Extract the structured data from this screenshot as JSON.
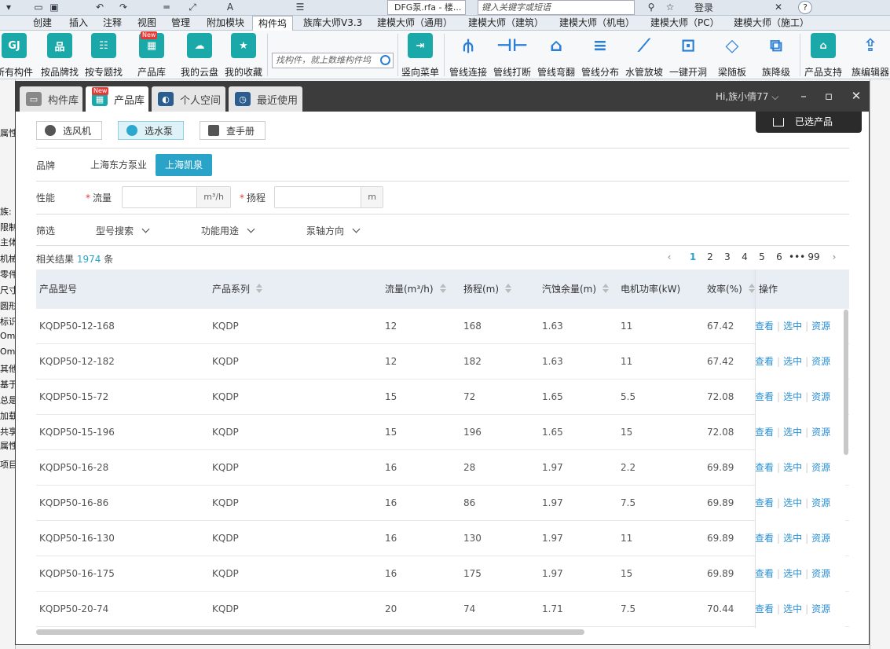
{
  "app": {
    "doc_name": "DFG泵.rfa - 楼...",
    "search_placeholder": "键入关键字或短语",
    "login": "登录",
    "help": "?"
  },
  "menubar": {
    "tabs": [
      "创建",
      "插入",
      "注释",
      "视图",
      "管理",
      "附加模块",
      "构件坞",
      "族库大师V3.3",
      "建模大师（通用）",
      "建模大师（建筑）",
      "建模大师（机电）",
      "建模大师（PC）",
      "建模大师（施工）"
    ],
    "active": "构件坞"
  },
  "ribbon": {
    "buttons_left": [
      {
        "label": "所有构件",
        "icon": "gj-logo-icon"
      },
      {
        "label": "按品牌找",
        "icon": "brand-icon"
      },
      {
        "label": "按专题找",
        "icon": "topic-icon"
      },
      {
        "label": "产品库",
        "icon": "product-library-icon",
        "badge": "New"
      },
      {
        "label": "我的云盘",
        "icon": "cloud-disk-icon"
      },
      {
        "label": "我的收藏",
        "icon": "star-icon"
      }
    ],
    "search_placeholder": "找构件，就上数维构件坞",
    "buttons_right": [
      {
        "label": "竖向菜单",
        "icon": "vertical-menu-icon"
      },
      {
        "label": "管线连接",
        "icon": "pipe-connect-icon"
      },
      {
        "label": "管线打断",
        "icon": "pipe-break-icon"
      },
      {
        "label": "管线弯翻",
        "icon": "pipe-bend-icon"
      },
      {
        "label": "管线分布",
        "icon": "pipe-distribute-icon"
      },
      {
        "label": "水管放坡",
        "icon": "pipe-slope-icon"
      },
      {
        "label": "一键开洞",
        "icon": "open-hole-icon"
      },
      {
        "label": "梁随板",
        "icon": "beam-slab-icon"
      },
      {
        "label": "族降级",
        "icon": "family-downgrade-icon"
      },
      {
        "label": "产品支持",
        "icon": "home-icon"
      },
      {
        "label": "族编辑器",
        "icon": "family-editor-icon"
      }
    ]
  },
  "left_panel": [
    "属性",
    "族:",
    "限制条",
    "主体",
    "机械",
    "零件",
    "尺寸",
    "圆形",
    "标识数",
    "Om",
    "Om",
    "其他",
    "基于",
    "总是",
    "加载",
    "共享",
    "属性",
    "项目浏"
  ],
  "dialog": {
    "tabs": [
      {
        "label": "构件库",
        "icon": "component-library-icon"
      },
      {
        "label": "产品库",
        "icon": "product-library-icon",
        "badge": "New"
      },
      {
        "label": "个人空间",
        "icon": "personal-space-icon"
      },
      {
        "label": "最近使用",
        "icon": "recent-use-icon"
      }
    ],
    "active_tab": "产品库",
    "user": "Hi,族小倩77",
    "cart_label": "已选产品",
    "sub_tabs": [
      "选风机",
      "选水泵",
      "查手册"
    ],
    "active_sub_tab": "选水泵",
    "brand_label": "品牌",
    "brands": [
      "上海东方泵业",
      "上海凯泉"
    ],
    "active_brand": "上海凯泉",
    "performance_label": "性能",
    "flow_label": "流量",
    "flow_unit": "m³/h",
    "head_label": "扬程",
    "head_unit": "m",
    "filter_label": "筛选",
    "filters": [
      "型号搜索",
      "功能用途",
      "泵轴方向"
    ],
    "result_prefix": "相关结果",
    "result_count": "1974",
    "result_suffix": "条",
    "pagination": {
      "pages": [
        "1",
        "2",
        "3",
        "4",
        "5",
        "6",
        "•••",
        "99"
      ],
      "current": "1"
    },
    "table": {
      "headers": [
        "产品型号",
        "产品系列",
        "流量(m³/h)",
        "扬程(m)",
        "汽蚀余量(m)",
        "电机功率(kW)",
        "效率(%)",
        "操作"
      ],
      "actions": [
        "查看",
        "选中",
        "资源"
      ],
      "rows": [
        [
          "KQDP50-12-168",
          "KQDP",
          "12",
          "168",
          "1.63",
          "11",
          "67.42"
        ],
        [
          "KQDP50-12-182",
          "KQDP",
          "12",
          "182",
          "1.63",
          "11",
          "67.42"
        ],
        [
          "KQDP50-15-72",
          "KQDP",
          "15",
          "72",
          "1.65",
          "5.5",
          "72.08"
        ],
        [
          "KQDP50-15-196",
          "KQDP",
          "15",
          "196",
          "1.65",
          "15",
          "72.08"
        ],
        [
          "KQDP50-16-28",
          "KQDP",
          "16",
          "28",
          "1.97",
          "2.2",
          "69.89"
        ],
        [
          "KQDP50-16-86",
          "KQDP",
          "16",
          "86",
          "1.97",
          "7.5",
          "69.89"
        ],
        [
          "KQDP50-16-130",
          "KQDP",
          "16",
          "130",
          "1.97",
          "11",
          "69.89"
        ],
        [
          "KQDP50-16-175",
          "KQDP",
          "16",
          "175",
          "1.97",
          "15",
          "69.89"
        ],
        [
          "KQDP50-20-74",
          "KQDP",
          "20",
          "74",
          "1.71",
          "7.5",
          "70.44"
        ]
      ]
    }
  }
}
